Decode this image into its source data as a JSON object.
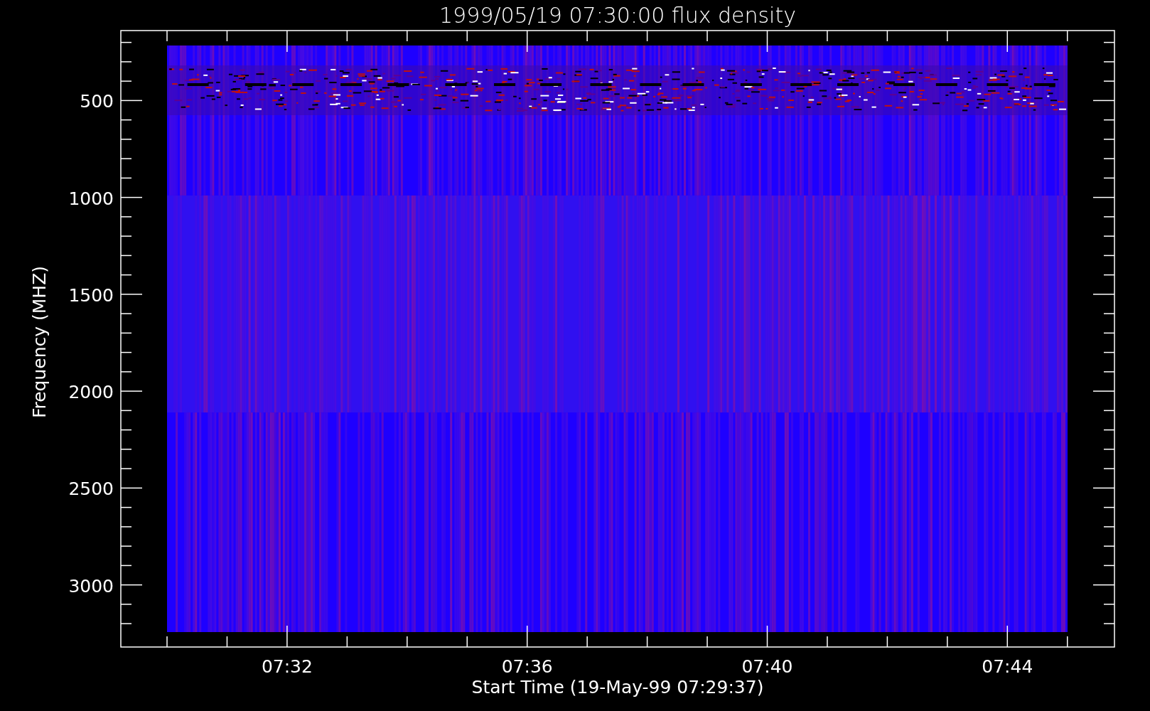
{
  "plot": {
    "title": "1999/05/19 07:30:00 flux density",
    "y_axis": {
      "label": "Frequency (MHZ)",
      "tick_labels": [
        "500",
        "1000",
        "1500",
        "2000",
        "2500",
        "3000"
      ]
    },
    "x_axis": {
      "label": "Start Time (19-May-99 07:29:37)",
      "tick_labels": [
        "07:32",
        "07:36",
        "07:40",
        "07:44"
      ]
    }
  }
}
